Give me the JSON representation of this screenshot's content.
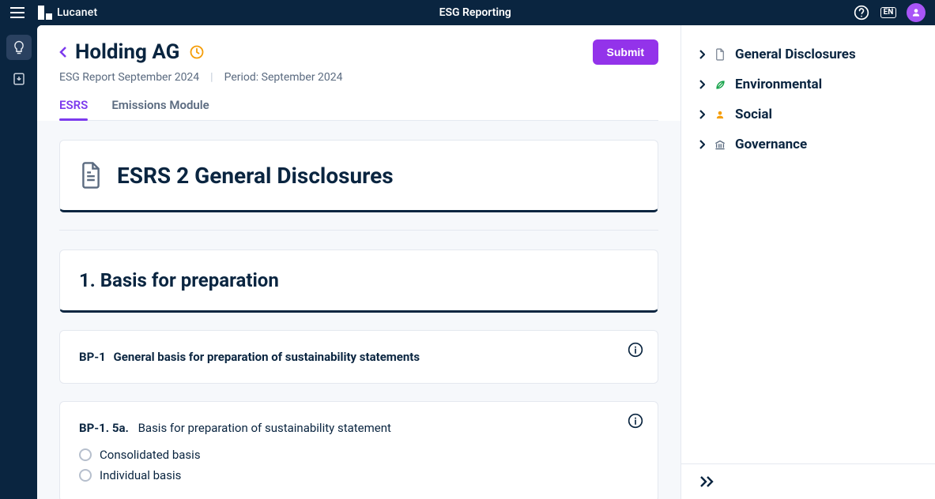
{
  "brand": {
    "name": "Lucanet"
  },
  "app_title": "ESG Reporting",
  "lang_badge": "EN",
  "header": {
    "entity": "Holding AG",
    "report_name": "ESG Report September 2024",
    "period_label": "Period: September 2024",
    "submit_label": "Submit"
  },
  "tabs": [
    {
      "label": "ESRS",
      "active": true
    },
    {
      "label": "Emissions Module",
      "active": false
    }
  ],
  "hero": {
    "title": "ESRS 2 General Disclosures"
  },
  "section1": {
    "title": "1. Basis for preparation"
  },
  "bp1": {
    "code": "BP-1",
    "title": "General basis for preparation of sustainability statements"
  },
  "bp1_5a": {
    "code": "BP-1. 5a.",
    "title": "Basis for preparation of sustainability statement",
    "options": [
      "Consolidated basis",
      "Individual basis"
    ]
  },
  "outline": [
    {
      "label": "General Disclosures",
      "icon": "doc"
    },
    {
      "label": "Environmental",
      "icon": "env"
    },
    {
      "label": "Social",
      "icon": "soc"
    },
    {
      "label": "Governance",
      "icon": "gov"
    }
  ]
}
